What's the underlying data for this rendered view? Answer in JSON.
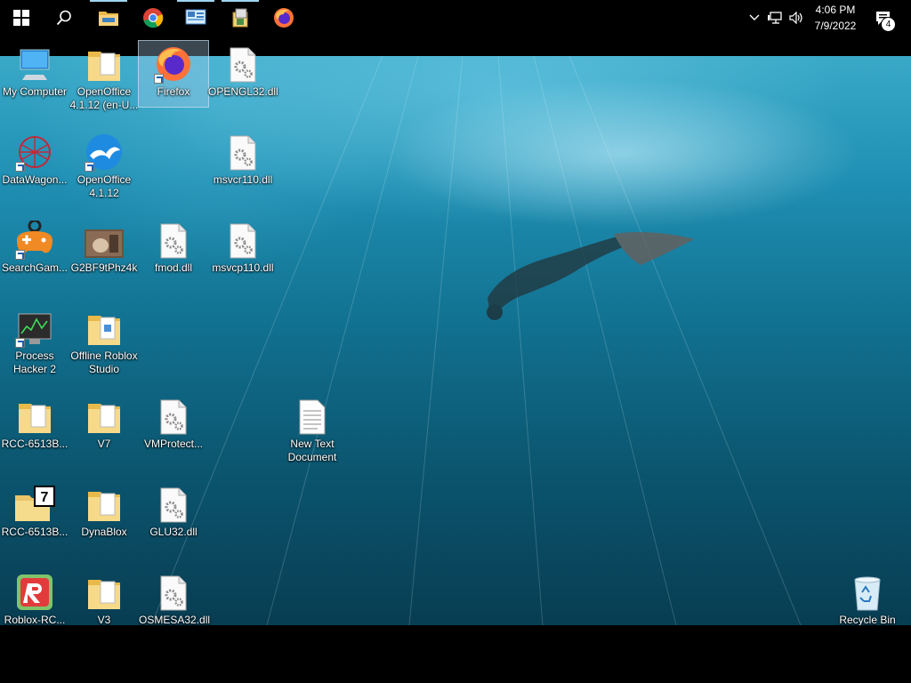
{
  "taskbar": {
    "pinned": [
      {
        "name": "start-button",
        "icon": "windows-logo-icon"
      },
      {
        "name": "search-button",
        "icon": "search-icon"
      },
      {
        "name": "file-explorer",
        "icon": "folder-icon"
      },
      {
        "name": "chrome",
        "icon": "chrome-icon"
      },
      {
        "name": "control-panel",
        "icon": "control-panel-icon"
      },
      {
        "name": "app-window",
        "icon": "app-window-icon"
      },
      {
        "name": "firefox",
        "icon": "firefox-icon"
      }
    ],
    "tray": {
      "time": "4:06 PM",
      "date": "7/9/2022",
      "notification_count": "4"
    }
  },
  "desktop": {
    "icons": [
      {
        "label": "My Computer"
      },
      {
        "label": "OpenOffice 4.1.12 (en-U..."
      },
      {
        "label": "Firefox"
      },
      {
        "label": "OPENGL32.dll"
      },
      {
        "label": "DataWagon..."
      },
      {
        "label": "OpenOffice 4.1.12"
      },
      {
        "label": "msvcr110.dll"
      },
      {
        "label": "SearchGam..."
      },
      {
        "label": "G2BF9tPhz4k"
      },
      {
        "label": "fmod.dll"
      },
      {
        "label": "msvcp110.dll"
      },
      {
        "label": "Process Hacker 2"
      },
      {
        "label": "Offline Roblox Studio"
      },
      {
        "label": "RCC-6513B..."
      },
      {
        "label": "V7"
      },
      {
        "label": "VMProtect..."
      },
      {
        "label": "New Text Document"
      },
      {
        "label": "RCC-6513B..."
      },
      {
        "label": "DynaBlox"
      },
      {
        "label": "GLU32.dll"
      },
      {
        "label": "Roblox-RC..."
      },
      {
        "label": "V3"
      },
      {
        "label": "OSMESA32.dll"
      },
      {
        "label": "Recycle Bin"
      }
    ]
  }
}
